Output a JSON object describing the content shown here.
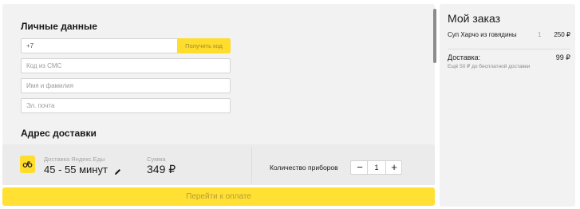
{
  "personal": {
    "title": "Личные данные",
    "phone_value": "+7",
    "get_code_label": "Получить код",
    "sms_placeholder": "Код из СМС",
    "name_placeholder": "Имя и фамилия",
    "email_placeholder": "Эл. почта"
  },
  "address": {
    "title": "Адрес доставки"
  },
  "delivery": {
    "service_label": "Доставка Яндекс.Еды",
    "time": "45 - 55 минут",
    "sum_label": "Сумма",
    "sum_value": "349 ₽",
    "cutlery_label": "Количество приборов",
    "cutlery_count": "1",
    "minus_label": "−",
    "plus_label": "+",
    "courier_icon": "courier-icon",
    "edit_icon": "pencil-icon"
  },
  "pay_button": "Перейти к оплате",
  "order": {
    "title": "Мой заказ",
    "items": [
      {
        "name": "Суп Харчо из говядины",
        "qty": "1",
        "price": "250 ₽"
      }
    ],
    "delivery_label": "Доставка:",
    "delivery_price": "99 ₽",
    "free_delivery_note": "Ещё 50 ₽ до бесплатной доставки"
  },
  "colors": {
    "accent_yellow": "#ffdd2d",
    "panel_gray": "#f2f2f2",
    "muted_text": "#a4a4a4"
  }
}
